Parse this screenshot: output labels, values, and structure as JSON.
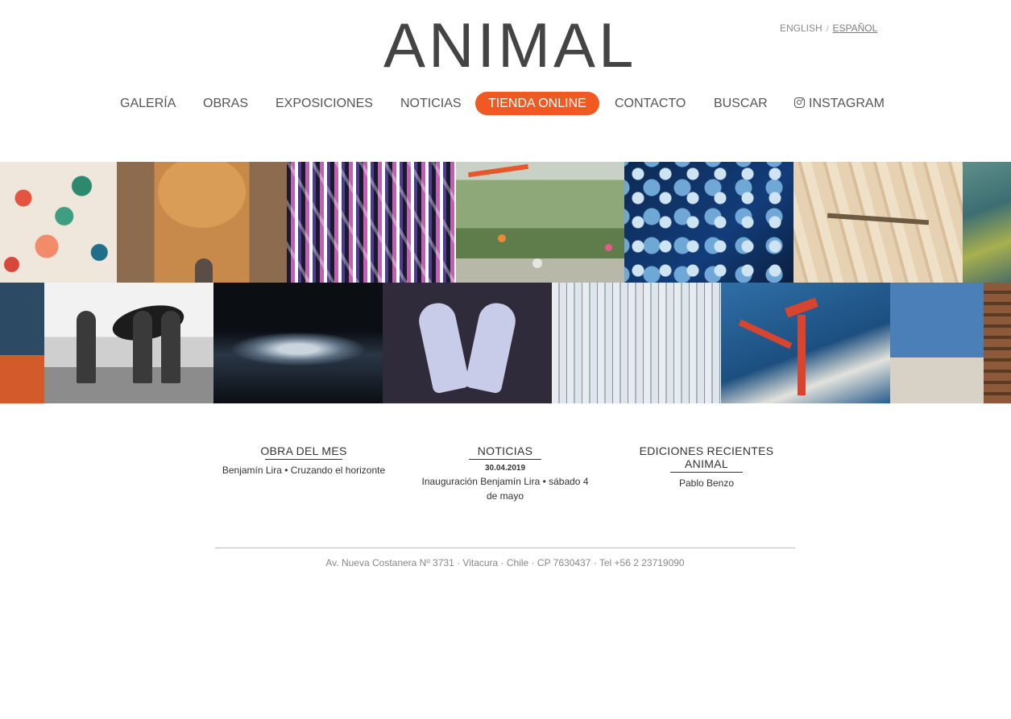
{
  "brand": {
    "logo_text": "ANIMAL"
  },
  "languages": {
    "english": "ENGLISH",
    "separator": "/",
    "spanish": "ESPAÑOL"
  },
  "nav": {
    "galeria": "GALERÍA",
    "obras": "OBRAS",
    "exposiciones": "EXPOSICIONES",
    "noticias": "NOTICIAS",
    "tienda": "TIENDA ONLINE",
    "contacto": "CONTACTO",
    "buscar": "BUSCAR",
    "instagram": "INSTAGRAM",
    "instagram_icon": "instagram-icon"
  },
  "colors": {
    "accent": "#f05a22",
    "text": "#555555",
    "footer_text": "#888888"
  },
  "sections": {
    "obra_del_mes": {
      "title": "OBRA DEL MES",
      "text": "Benjamín Lira • Cruzando el horizonte"
    },
    "noticias": {
      "title": "NOTICIAS",
      "date": "30.04.2019",
      "text": "Inauguración Benjamín Lira • sábado 4 de mayo"
    },
    "ediciones": {
      "title_line1": "EDICIONES RECIENTES",
      "title_line2": "ANIMAL",
      "text": "Pablo Benzo"
    }
  },
  "footer": {
    "address": "Av. Nueva Costanera Nº 3731 · Vitacura · Chile · CP 7630437 · Tel +56 2 23719090"
  }
}
